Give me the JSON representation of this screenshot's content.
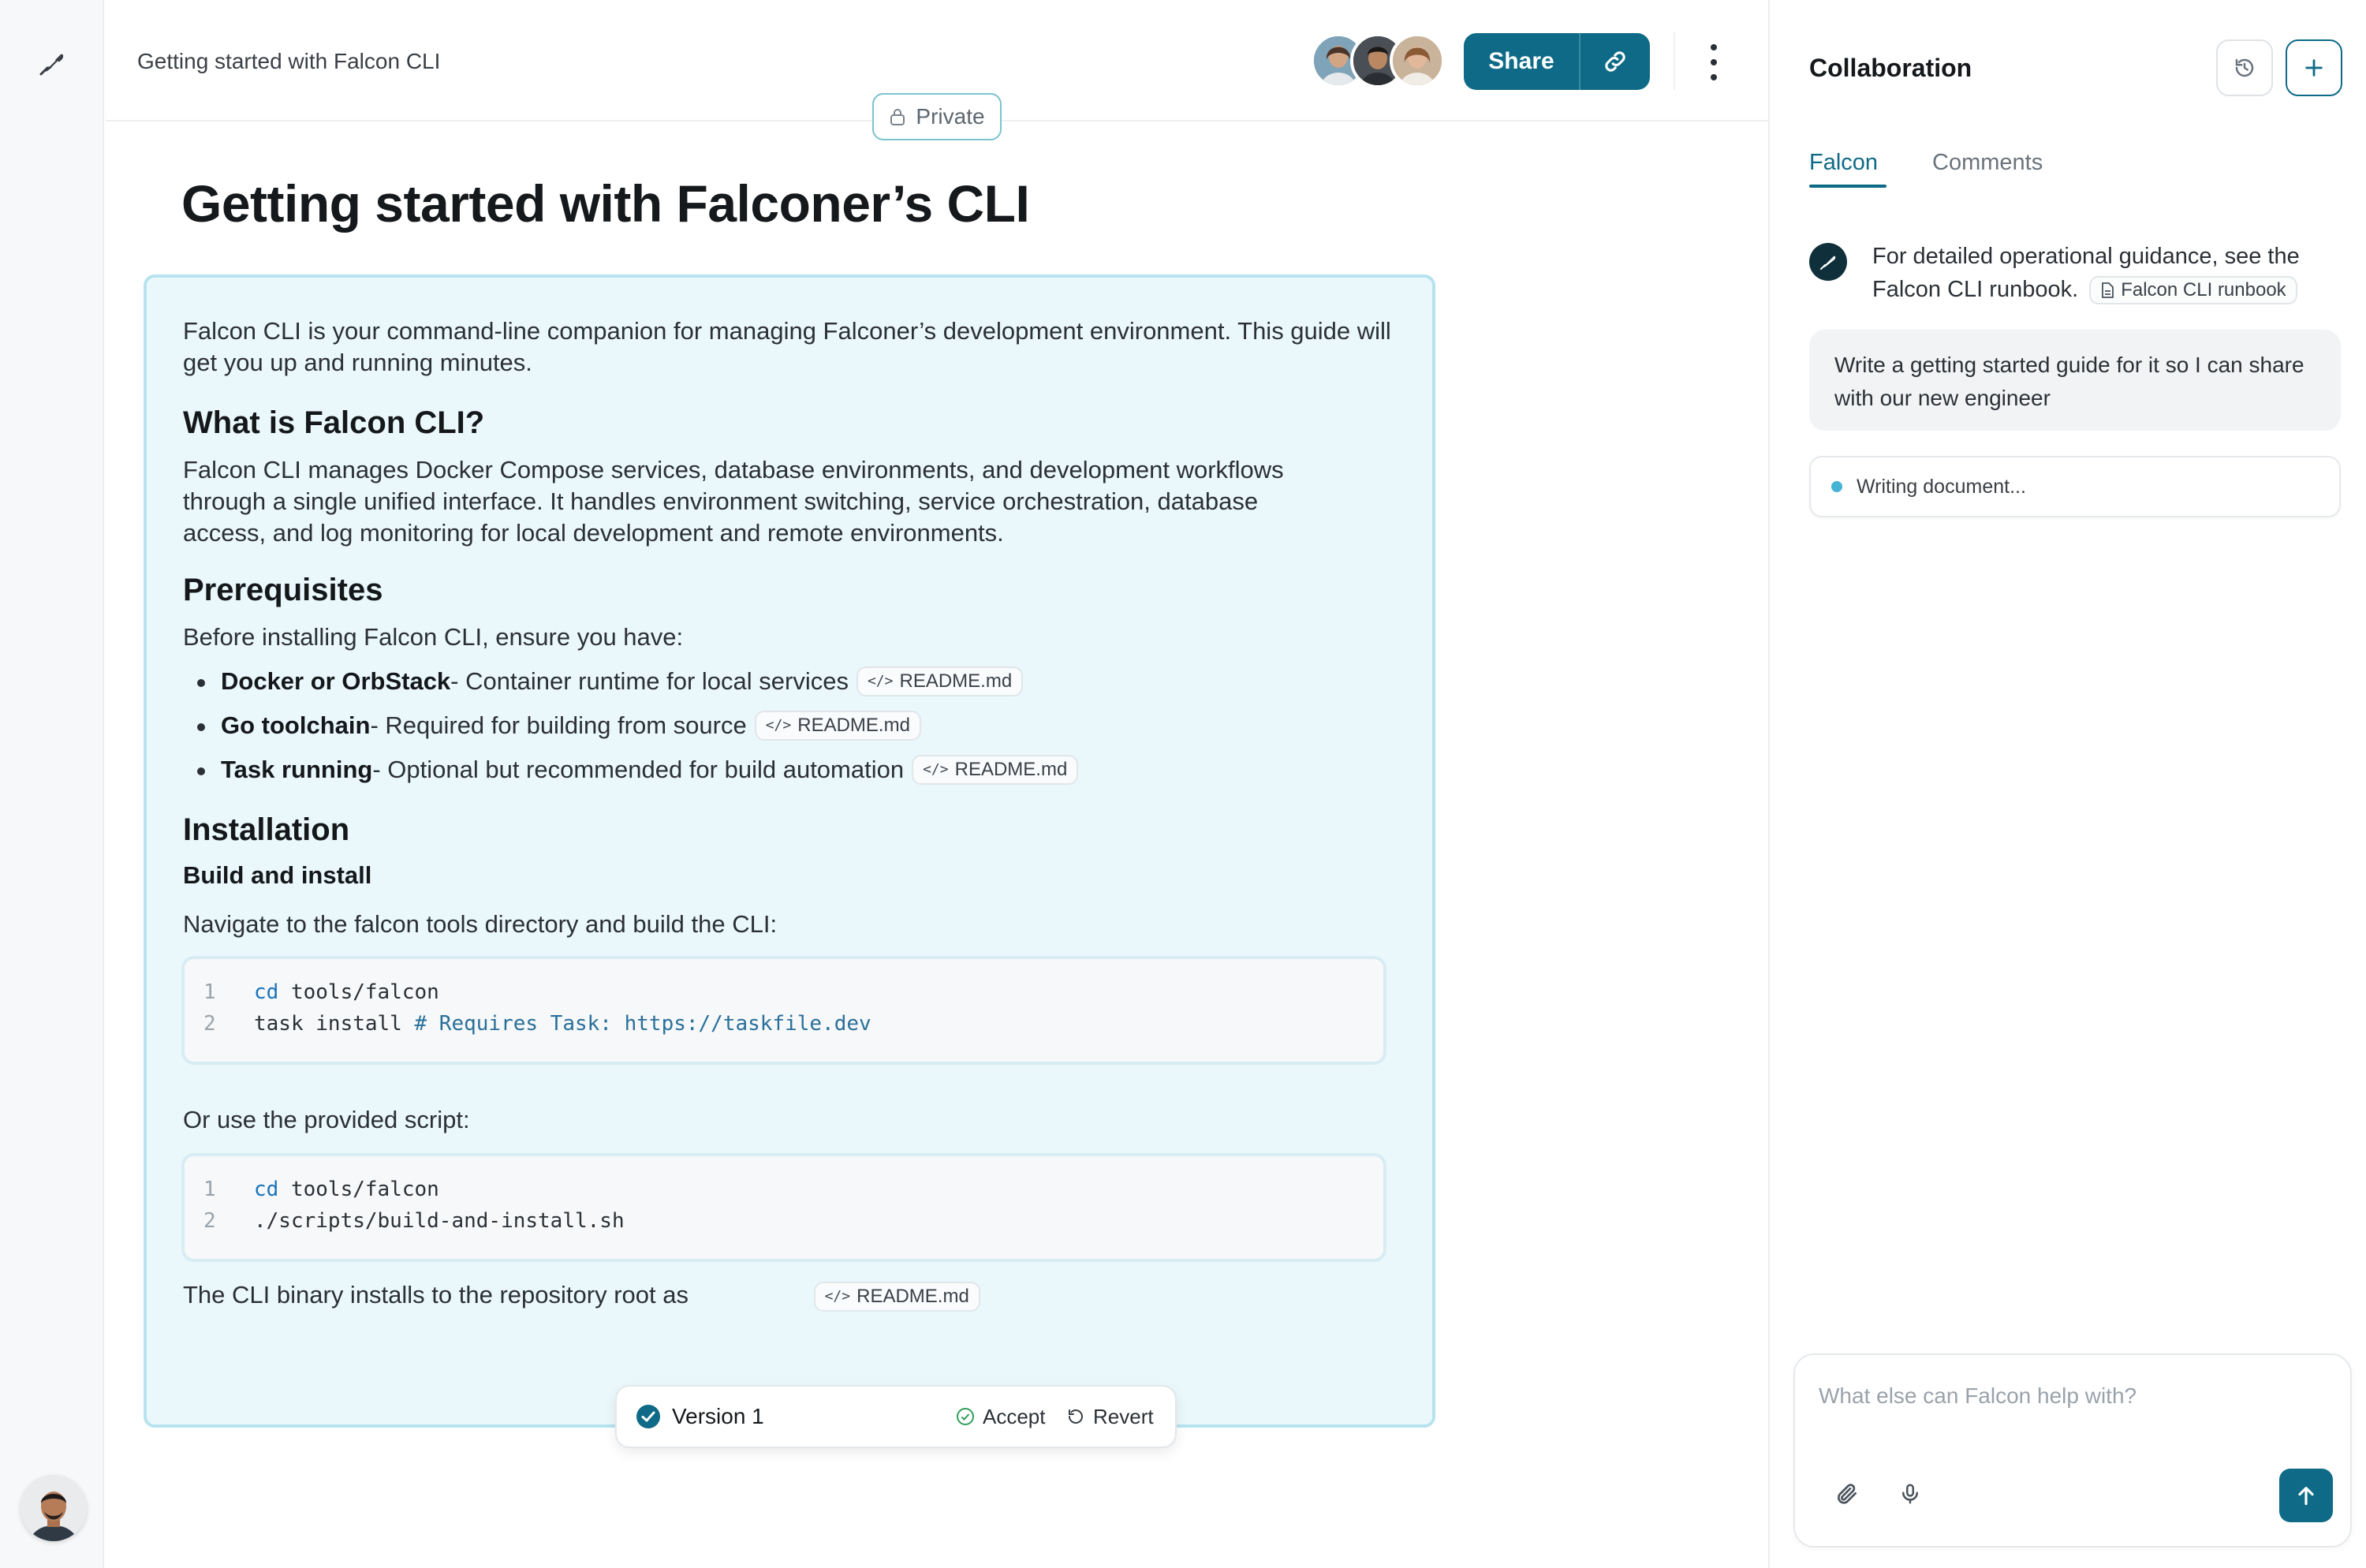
{
  "header": {
    "breadcrumb": "Getting started with Falcon CLI",
    "share_label": "Share",
    "visibility_label": "Private"
  },
  "document": {
    "title": "Getting started with Falconer’s CLI",
    "intro": "Falcon CLI is your command-line companion for managing Falconer’s development environment. This guide will get you up and running minutes.",
    "sections": {
      "what_heading": "What is Falcon CLI?",
      "what_body": "Falcon CLI manages Docker Compose services, database environments, and development workflows through a single unified interface. It handles environment switching, service orchestration, database access, and log monitoring for local development and remote environments.",
      "prereq_heading": "Prerequisites",
      "prereq_intro": "Before installing Falcon CLI, ensure you have:",
      "prereqs": [
        {
          "name": "Docker or OrbStack",
          "desc": " - Container runtime for local services",
          "ref": "README.md"
        },
        {
          "name": "Go toolchain",
          "desc": " - Required for building from source",
          "ref": "README.md"
        },
        {
          "name": "Task running",
          "desc": " - Optional but recommended for build automation",
          "ref": "README.md"
        }
      ],
      "install_heading": "Installation",
      "build_heading": "Build and install",
      "build_intro": "Navigate to the falcon tools directory and build the CLI:",
      "code1": {
        "line1_num": "1",
        "line1_kw": "cd",
        "line1_rest": " tools/falcon",
        "line2_num": "2",
        "line2_text": "task install ",
        "line2_comment": "# Requires Task: https://taskfile.dev"
      },
      "script_intro": "Or use the provided script:",
      "code2": {
        "line1_num": "1",
        "line1_kw": "cd",
        "line1_rest": " tools/falcon",
        "line2_num": "2",
        "line2_text": "./scripts/build-and-install.sh"
      },
      "binary_text": "The CLI binary installs to the repository root as",
      "binary_ref": "README.md"
    }
  },
  "version_bar": {
    "label": "Version 1",
    "accept": "Accept",
    "revert": "Revert"
  },
  "panel": {
    "title": "Collaboration",
    "tabs": [
      "Falcon",
      "Comments"
    ],
    "ai_message": "For detailed operational guidance, see the Falcon CLI runbook.",
    "ai_chip": "Falcon CLI runbook",
    "user_message": "Write a getting started guide for it so I can share with our new engineer",
    "status": "Writing document...",
    "composer_placeholder": "What else can Falcon help with?"
  },
  "colors": {
    "brand": "#0e6a86",
    "doc_highlight_bg": "#eaf8fc",
    "doc_highlight_border": "#b7e3ef",
    "status_dot": "#45b3d4",
    "accept_icon": "#2f9e5a"
  },
  "icons": {
    "rail_logo": "feather-icon",
    "lock": "lock-icon",
    "link": "link-icon",
    "more": "kebab-menu-icon",
    "code_ref": "code-icon",
    "doc_ref": "document-icon",
    "history": "history-icon",
    "new": "plus-icon",
    "check": "check-circle-icon",
    "revert": "undo-icon",
    "attach": "paperclip-icon",
    "mic": "microphone-icon",
    "send": "arrow-up-icon"
  }
}
